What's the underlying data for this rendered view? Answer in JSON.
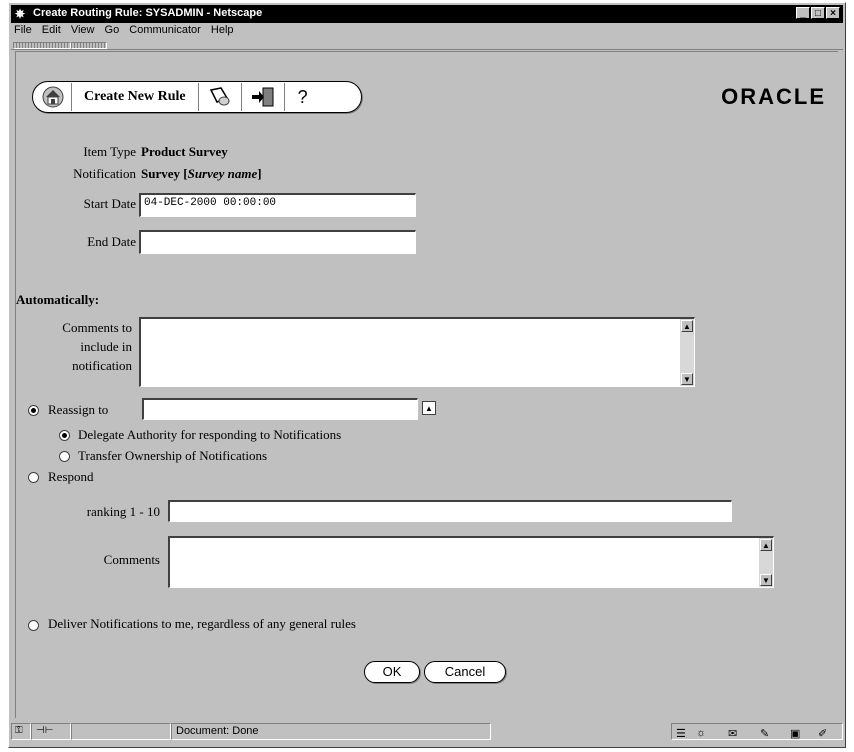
{
  "window": {
    "title": "Create Routing Rule: SYSADMIN - Netscape",
    "minimize": "_",
    "maximize": "□",
    "close": "×"
  },
  "menu": [
    "File",
    "Edit",
    "View",
    "Go",
    "Communicator",
    "Help"
  ],
  "toolbar": {
    "title": "Create New Rule",
    "help": "?"
  },
  "brand": "ORACLE",
  "form": {
    "item_type_label": "Item Type",
    "item_type_value": "Product Survey",
    "notification_label": "Notification",
    "notification_value_prefix": "Survey [",
    "notification_value_italic": "Survey name",
    "notification_value_suffix": "]",
    "start_date_label": "Start Date",
    "start_date_value": "04-DEC-2000 00:00:00",
    "end_date_label": "End Date",
    "end_date_value": "",
    "automatically_label": "Automatically:",
    "comments_label_lines": [
      "Comments to",
      "include in",
      "notification"
    ],
    "reassign_label": "Reassign to",
    "reassign_value": "",
    "delegate_label": "Delegate Authority for responding to Notifications",
    "transfer_label": "Transfer Ownership of Notifications",
    "respond_label": "Respond",
    "ranking_label": "ranking 1 - 10",
    "ranking_value": "",
    "comments_label": "Comments",
    "deliver_label": "Deliver Notifications to me, regardless of any general rules",
    "ok_label": "OK",
    "cancel_label": "Cancel"
  },
  "status": {
    "text": "Document: Done"
  }
}
